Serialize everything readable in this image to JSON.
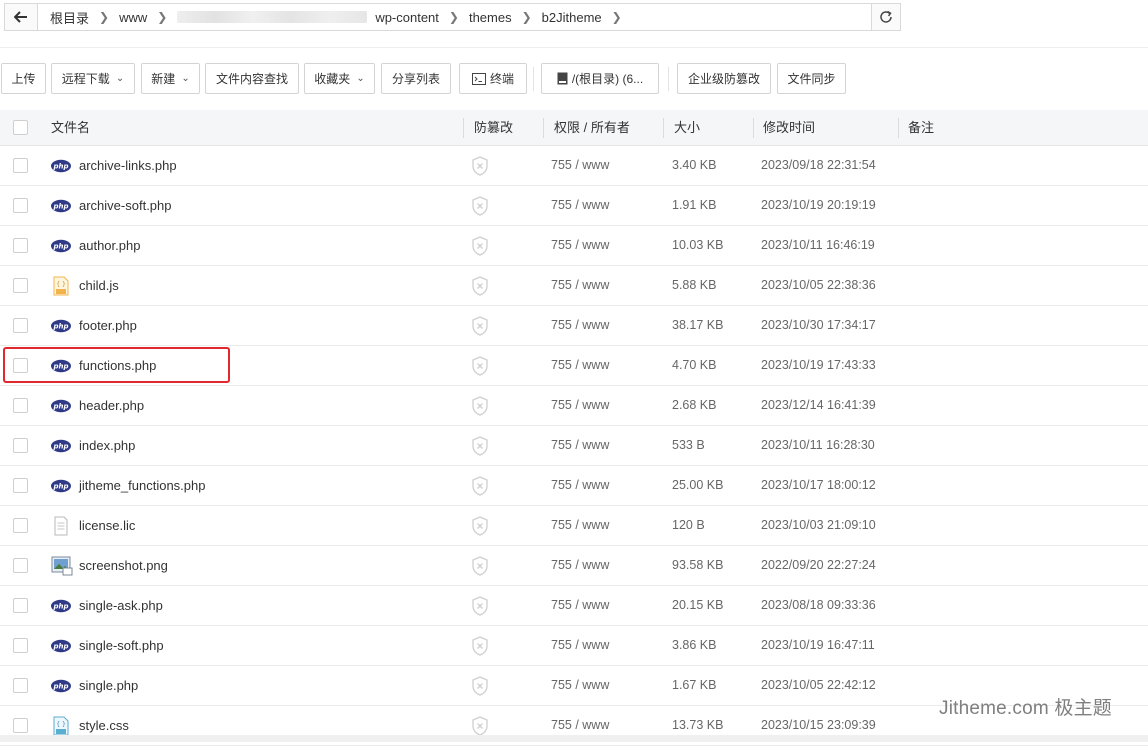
{
  "breadcrumb": {
    "items": [
      "根目录",
      "www",
      "wp-content",
      "themes",
      "b2Jitheme"
    ]
  },
  "toolbar": {
    "upload": "上传",
    "remote_download": "远程下载",
    "new": "新建",
    "search_content": "文件内容查找",
    "favorites": "收藏夹",
    "share_list": "分享列表",
    "terminal": "终端",
    "disk": "/(根目录) (6...",
    "tamper_proof": "企业级防篡改",
    "file_sync": "文件同步"
  },
  "table": {
    "headers": {
      "name": "文件名",
      "tamper": "防篡改",
      "perm": "权限 / 所有者",
      "size": "大小",
      "mtime": "修改时间",
      "note": "备注"
    },
    "rows": [
      {
        "icon": "php",
        "name": "archive-links.php",
        "perm": "755 / www",
        "size": "3.40 KB",
        "mtime": "2023/09/18 22:31:54"
      },
      {
        "icon": "php",
        "name": "archive-soft.php",
        "perm": "755 / www",
        "size": "1.91 KB",
        "mtime": "2023/10/19 20:19:19"
      },
      {
        "icon": "php",
        "name": "author.php",
        "perm": "755 / www",
        "size": "10.03 KB",
        "mtime": "2023/10/11 16:46:19"
      },
      {
        "icon": "js",
        "name": "child.js",
        "perm": "755 / www",
        "size": "5.88 KB",
        "mtime": "2023/10/05 22:38:36"
      },
      {
        "icon": "php",
        "name": "footer.php",
        "perm": "755 / www",
        "size": "38.17 KB",
        "mtime": "2023/10/30 17:34:17"
      },
      {
        "icon": "php",
        "name": "functions.php",
        "perm": "755 / www",
        "size": "4.70 KB",
        "mtime": "2023/10/19 17:43:33"
      },
      {
        "icon": "php",
        "name": "header.php",
        "perm": "755 / www",
        "size": "2.68 KB",
        "mtime": "2023/12/14 16:41:39"
      },
      {
        "icon": "php",
        "name": "index.php",
        "perm": "755 / www",
        "size": "533 B",
        "mtime": "2023/10/11 16:28:30"
      },
      {
        "icon": "php",
        "name": "jitheme_functions.php",
        "perm": "755 / www",
        "size": "25.00 KB",
        "mtime": "2023/10/17 18:00:12"
      },
      {
        "icon": "text",
        "name": "license.lic",
        "perm": "755 / www",
        "size": "120 B",
        "mtime": "2023/10/03 21:09:10"
      },
      {
        "icon": "image",
        "name": "screenshot.png",
        "perm": "755 / www",
        "size": "93.58 KB",
        "mtime": "2022/09/20 22:27:24"
      },
      {
        "icon": "php",
        "name": "single-ask.php",
        "perm": "755 / www",
        "size": "20.15 KB",
        "mtime": "2023/08/18 09:33:36"
      },
      {
        "icon": "php",
        "name": "single-soft.php",
        "perm": "755 / www",
        "size": "3.86 KB",
        "mtime": "2023/10/19 16:47:11"
      },
      {
        "icon": "php",
        "name": "single.php",
        "perm": "755 / www",
        "size": "1.67 KB",
        "mtime": "2023/10/05 22:42:12"
      },
      {
        "icon": "css",
        "name": "style.css",
        "perm": "755 / www",
        "size": "13.73 KB",
        "mtime": "2023/10/15 23:09:39"
      }
    ]
  },
  "watermark": "Jitheme.com 极主题",
  "colors": {
    "highlight": "#e0282e",
    "php_badge": "#2f3a86",
    "js_icon": "#f1b44c"
  }
}
